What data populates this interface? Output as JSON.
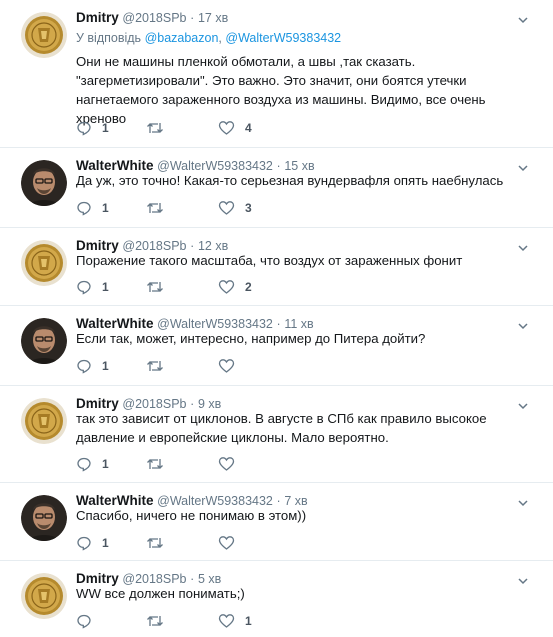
{
  "tweets": [
    {
      "name": "Dmitry",
      "handle": "@2018SPb",
      "dot": "·",
      "time": "17 хв",
      "avatar": "gold-coin-avatar",
      "reply_prefix": "У відповідь",
      "reply_users": [
        "@bazabazon",
        "@WalterW59383432"
      ],
      "text": "Они не машины пленкой обмотали, а швы ,так сказать. \"загерметизировали\". Это важно. Это значит, они боятся утечки нагнетаемого зараженного воздуха из машины. Видимо, все очень хреново",
      "replies": "1",
      "retweets": "",
      "likes": "4"
    },
    {
      "name": "WalterWhite",
      "handle": "@WalterW59383432",
      "dot": "·",
      "time": "15 хв",
      "avatar": "walter-white-avatar",
      "text": "Да уж, это точно! Какая-то серьезная вундервафля опять наебнулась",
      "replies": "1",
      "retweets": "",
      "likes": "3"
    },
    {
      "name": "Dmitry",
      "handle": "@2018SPb",
      "dot": "·",
      "time": "12 хв",
      "avatar": "gold-coin-avatar",
      "text": "Поражение такого масштаба, что воздух от зараженных фонит",
      "replies": "1",
      "retweets": "",
      "likes": "2"
    },
    {
      "name": "WalterWhite",
      "handle": "@WalterW59383432",
      "dot": "·",
      "time": "11 хв",
      "avatar": "walter-white-avatar",
      "text": "Если так, может, интересно, например до Питера дойти?",
      "replies": "1",
      "retweets": "",
      "likes": ""
    },
    {
      "name": "Dmitry",
      "handle": "@2018SPb",
      "dot": "·",
      "time": "9 хв",
      "avatar": "gold-coin-avatar",
      "text": "так это зависит от циклонов. В августе в СПб как правило высокое давление и европейские циклоны. Мало вероятно.",
      "replies": "1",
      "retweets": "",
      "likes": ""
    },
    {
      "name": "WalterWhite",
      "handle": "@WalterW59383432",
      "dot": "·",
      "time": "7 хв",
      "avatar": "walter-white-avatar",
      "text": "Спасибо, ничего не понимаю в этом))",
      "replies": "1",
      "retweets": "",
      "likes": ""
    },
    {
      "name": "Dmitry",
      "handle": "@2018SPb",
      "dot": "·",
      "time": "5 хв",
      "avatar": "gold-coin-avatar",
      "text": "WW все должен понимать;)",
      "replies": "",
      "retweets": "",
      "likes": "1"
    }
  ],
  "colors": {
    "link": "#1b95e0",
    "meta": "#657786",
    "divider": "#e6ecf0"
  }
}
